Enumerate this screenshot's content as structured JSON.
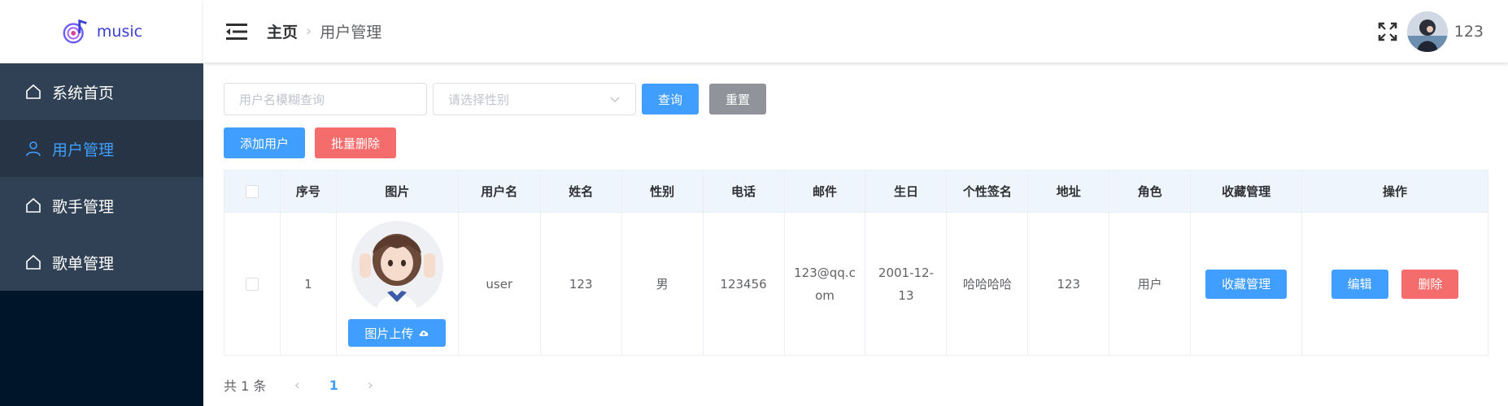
{
  "brand": {
    "name": "music",
    "logo_icon": "music-note-icon",
    "accent": "#3a3fd0"
  },
  "sidebar": {
    "items": [
      {
        "label": "系统首页",
        "icon": "home-icon",
        "active": false
      },
      {
        "label": "用户管理",
        "icon": "user-icon",
        "active": true
      },
      {
        "label": "歌手管理",
        "icon": "home-icon",
        "active": false
      },
      {
        "label": "歌单管理",
        "icon": "home-icon",
        "active": false
      }
    ]
  },
  "header": {
    "breadcrumb": {
      "home": "主页",
      "separator": "›",
      "current": "用户管理"
    },
    "username": "123"
  },
  "filters": {
    "name_placeholder": "用户名模糊查询",
    "gender_placeholder": "请选择性别",
    "query_label": "查询",
    "reset_label": "重置"
  },
  "actions": {
    "add_label": "添加用户",
    "batch_delete_label": "批量删除"
  },
  "table": {
    "columns": [
      "序号",
      "图片",
      "用户名",
      "姓名",
      "性别",
      "电话",
      "邮件",
      "生日",
      "个性签名",
      "地址",
      "角色",
      "收藏管理",
      "操作"
    ],
    "rows": [
      {
        "index": "1",
        "upload_label": "图片上传",
        "username": "user",
        "name": "123",
        "gender": "男",
        "phone": "123456",
        "email_line1": "123@qq.c",
        "email_line2": "om",
        "birthday_line1": "2001-12-",
        "birthday_line2": "13",
        "signature": "哈哈哈哈",
        "address": "123",
        "role": "用户",
        "collect_label": "收藏管理",
        "edit_label": "编辑",
        "delete_label": "删除"
      }
    ]
  },
  "pagination": {
    "total_text": "共 1 条",
    "current_page": "1",
    "prev": "‹",
    "next": "›"
  },
  "colors": {
    "primary": "#409eff",
    "danger": "#f56c6c",
    "info": "#909399",
    "sidebar_bg": "#304156",
    "sidebar_dark": "#001529"
  }
}
